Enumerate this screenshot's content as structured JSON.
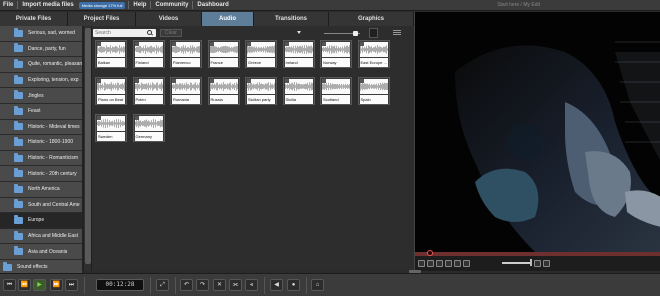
{
  "menu": {
    "file": "File",
    "import": "Import media files",
    "storage_badge": "Media storage 17% full",
    "help": "Help",
    "community": "Community",
    "dashboard": "Dashboard",
    "edit_title": "Start here / My Edit"
  },
  "tabs": [
    {
      "label": "Private Files",
      "active": false
    },
    {
      "label": "Project Files",
      "active": false
    },
    {
      "label": "Videos",
      "active": false
    },
    {
      "label": "Audio",
      "active": true
    },
    {
      "label": "Transitions",
      "active": false
    },
    {
      "label": "Graphics",
      "active": false
    }
  ],
  "sidebar": {
    "items": [
      {
        "label": "Serious, sad, worried"
      },
      {
        "label": "Dance, party, fun"
      },
      {
        "label": "Quite, romantic, pleasan"
      },
      {
        "label": "Exploring, tension, exp"
      },
      {
        "label": "Jingles"
      },
      {
        "label": "Feast"
      },
      {
        "label": "Historic - Mideval times"
      },
      {
        "label": "Historic - 1800-1900"
      },
      {
        "label": "Historic - Romanticism"
      },
      {
        "label": "Historic - 20th century"
      },
      {
        "label": "North America"
      },
      {
        "label": "South and Central Ame"
      },
      {
        "label": "Europe",
        "selected": true
      },
      {
        "label": "Africa and Middle East"
      },
      {
        "label": "Asia and Oceania"
      },
      {
        "label": "Sound effects",
        "root": true
      }
    ]
  },
  "library": {
    "search_placeholder": "Search",
    "clear_label": "Clear",
    "items": [
      "Balkan",
      "Finland",
      "Flamenco",
      "France",
      "Greece",
      "Ireland",
      "Norway",
      "East Europe ...",
      "Piano on Beat",
      "Polen",
      "Romania",
      "Russia",
      "Sicilian party",
      "Sicilia",
      "Scotland",
      "Spain",
      "Sweden",
      "Germany"
    ]
  },
  "transport": {
    "timecode": "00:12:28"
  },
  "colors": {
    "accent": "#5d7d99",
    "storage": "#3c6fa8",
    "play": "#7ed24f",
    "scrub": "#6e2f2f"
  }
}
